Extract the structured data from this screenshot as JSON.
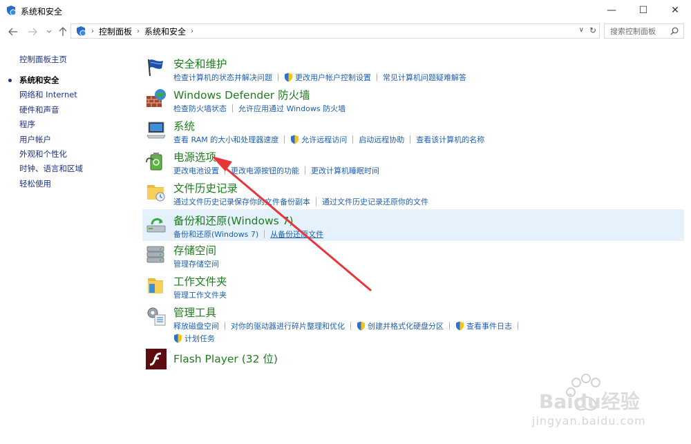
{
  "window": {
    "title": "系统和安全",
    "minimize": "—",
    "maximize": "☐",
    "close": "✕"
  },
  "address_bar": {
    "crumbs": [
      "控制面板",
      "系统和安全"
    ],
    "search_placeholder": "搜索控制面板"
  },
  "sidebar": {
    "home": "控制面板主页",
    "items": [
      {
        "label": "系统和安全",
        "active": true
      },
      {
        "label": "网络和 Internet"
      },
      {
        "label": "硬件和声音"
      },
      {
        "label": "程序"
      },
      {
        "label": "用户帐户"
      },
      {
        "label": "外观和个性化"
      },
      {
        "label": "时钟、语言和区域"
      },
      {
        "label": "轻松使用"
      }
    ]
  },
  "sections": [
    {
      "title": "安全和维护",
      "links": [
        "检查计算机的状态并解决问题",
        "更改用户帐户控制设置",
        "常见计算机问题疑难解答"
      ]
    },
    {
      "title": "Windows Defender 防火墙",
      "links": [
        "检查防火墙状态",
        "允许应用通过 Windows 防火墙"
      ]
    },
    {
      "title": "系统",
      "links": [
        "查看 RAM 的大小和处理器速度",
        "允许远程访问",
        "启动远程协助",
        "查看该计算机的名称"
      ]
    },
    {
      "title": "电源选项",
      "links": [
        "更改电池设置",
        "更改电源按钮的功能",
        "更改计算机睡眠时间"
      ]
    },
    {
      "title": "文件历史记录",
      "links": [
        "通过文件历史记录保存你的文件备份副本",
        "通过文件历史记录还原你的文件"
      ]
    },
    {
      "title": "备份和还原(Windows 7)",
      "links": [
        "备份和还原(Windows 7)",
        "从备份还原文件"
      ]
    },
    {
      "title": "存储空间",
      "links": [
        "管理存储空间"
      ]
    },
    {
      "title": "工作文件夹",
      "links": [
        "管理工作文件夹"
      ]
    },
    {
      "title": "管理工具",
      "links": [
        "释放磁盘空间",
        "对你的驱动器进行碎片整理和优化",
        "创建并格式化硬盘分区",
        "查看事件日志",
        "计划任务"
      ]
    },
    {
      "title": "Flash Player (32 位)",
      "links": []
    }
  ],
  "watermark": {
    "brand": "Baidu经验",
    "url": "jingyan.baidu.com"
  },
  "colors": {
    "section_title": "#1e7d1e",
    "link": "#1e5fb4",
    "nav_link": "#1e3287",
    "hover_bg": "#e5f1fb",
    "arrow": "#e8353a"
  }
}
